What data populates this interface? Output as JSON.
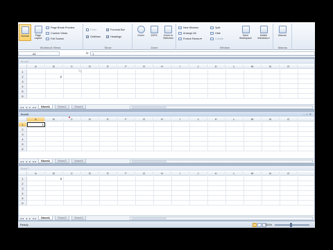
{
  "ribbon": {
    "workbook_views": {
      "label": "Workbook Views",
      "normal": "Normal",
      "page_layout": "Page Layout",
      "page_break_preview": "Page Break Preview",
      "custom_views": "Custom Views",
      "full_screen": "Full Screen"
    },
    "show": {
      "label": "Show",
      "ruler": "Ruler",
      "formula_bar": "Formula Bar",
      "gridlines": "Gridlines",
      "headings": "Headings"
    },
    "zoom": {
      "label": "Zoom",
      "zoom": "Zoom",
      "hundred": "100%",
      "zoom_to_selection": "Zoom to Selection"
    },
    "window": {
      "label": "Window",
      "new_window": "New Window",
      "arrange_all": "Arrange All",
      "freeze_panes": "Freeze Panes ▾",
      "split": "Split",
      "hide": "Hide",
      "unhide": "Unhide",
      "save_workspace": "Save Workspace",
      "switch_windows": "Switch Windows ▾"
    },
    "macros": {
      "label": "Macros",
      "macros": "Macros"
    }
  },
  "formula_bar": {
    "name_box": "A1",
    "fx": "fx",
    "value": "1"
  },
  "columns": [
    "A",
    "B",
    "C",
    "D",
    "E",
    "F",
    "G",
    "H",
    "I",
    "J",
    "K",
    "L",
    "M",
    "N",
    "O"
  ],
  "windows": [
    {
      "title": "Book6",
      "rows": [
        "1",
        "2",
        "3",
        "4",
        "5",
        "6"
      ],
      "cell_value": "2",
      "sheets": [
        "Sheet1",
        "Sheet2",
        "Sheet3"
      ]
    },
    {
      "title": "Book8",
      "rows": [
        "1",
        "2",
        "3",
        "4",
        "5",
        "6"
      ],
      "cell_value": "1",
      "sheets": [
        "Sheet1",
        "Sheet2",
        "Sheet3"
      ]
    },
    {
      "title": "Book7",
      "rows": [
        "1",
        "2",
        "3",
        "4",
        "5",
        "6"
      ],
      "cell_value": "3",
      "sheets": [
        "Sheet1",
        "Sheet2",
        "Sheet3"
      ]
    }
  ],
  "nav_glyphs": "◂◂ ◂ ▸ ▸▸",
  "status": {
    "ready": "Ready",
    "zoom": "100%"
  },
  "colors": {
    "accent_selected_header": "#f2c768",
    "ribbon_bg": "#e3eaf4",
    "workspace_bg": "#abb9cc"
  }
}
